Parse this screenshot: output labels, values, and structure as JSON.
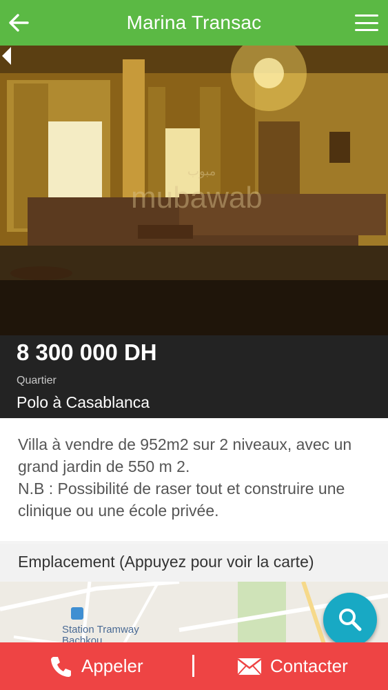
{
  "header": {
    "title": "Marina Transac",
    "back_icon": "arrow-left-icon",
    "menu_icon": "hamburger-menu-icon",
    "color": "#5bb944"
  },
  "hero": {
    "watermark": "mubawab",
    "watermark_arabic": "مبوب"
  },
  "listing": {
    "price": "8 300 000 DH",
    "district_label": "Quartier",
    "district_value": "Polo à Casablanca",
    "description_line1": "Villa à vendre de 952m2 sur 2 niveaux, avec un grand jardin de 550 m 2.",
    "description_line2": "N.B : Possibilité de raser tout et construire une clinique ou une école privée."
  },
  "location": {
    "label": "Emplacement (Appuyez pour voir la carte)",
    "map_place": "Station Tramway",
    "map_place2": "Bachkou"
  },
  "fab": {
    "icon": "search-icon",
    "color": "#18a9c4"
  },
  "actions": {
    "call_label": "Appeler",
    "contact_label": "Contacter",
    "call_icon": "phone-icon",
    "contact_icon": "envelope-icon",
    "color": "#ee4444"
  }
}
